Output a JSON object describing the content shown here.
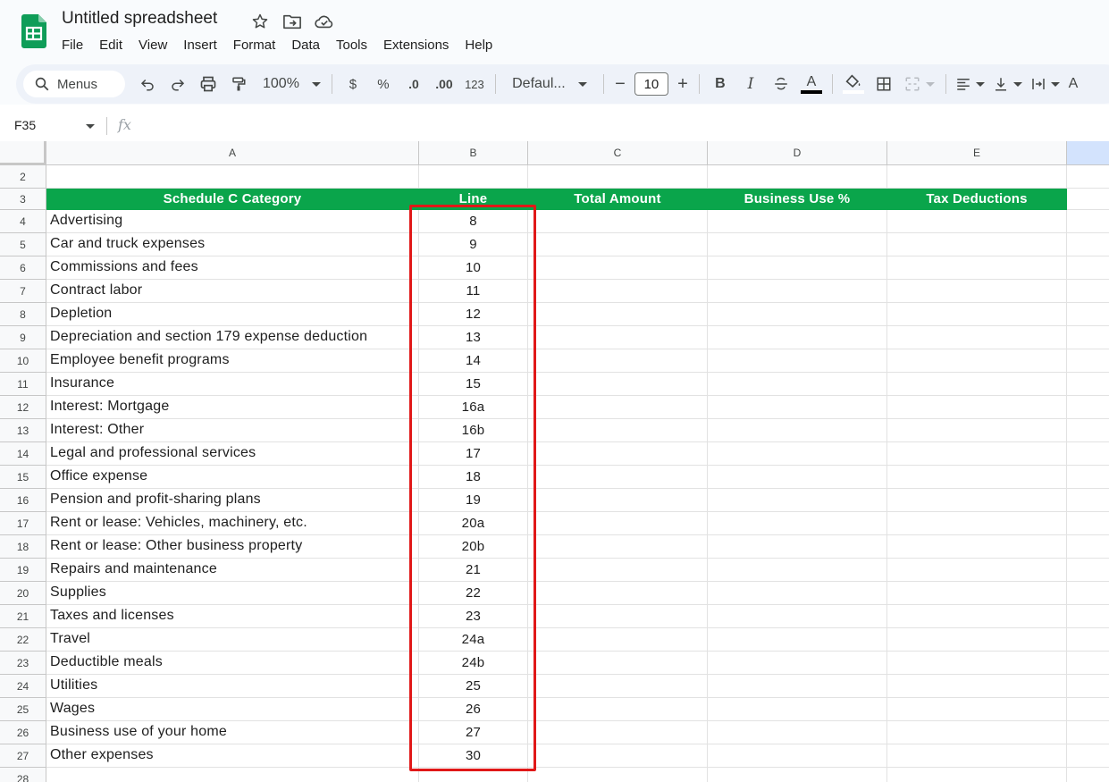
{
  "app": {
    "title": "Untitled spreadsheet",
    "menus": [
      "File",
      "Edit",
      "View",
      "Insert",
      "Format",
      "Data",
      "Tools",
      "Extensions",
      "Help"
    ]
  },
  "toolbar": {
    "search_label": "Menus",
    "zoom": "100%",
    "currency": "$",
    "percent": "%",
    "decrease_decimal": ".0",
    "increase_decimal": ".00",
    "number_format": "123",
    "font": "Defaul...",
    "font_size": "10",
    "minus": "−",
    "plus": "+",
    "bold": "B",
    "italic": "I",
    "text_color": "A"
  },
  "formula_bar": {
    "name_box": "F35",
    "fx": "fx"
  },
  "grid": {
    "columns": [
      "A",
      "B",
      "C",
      "D",
      "E"
    ],
    "header_row": {
      "row_number": "3",
      "cells": [
        "Schedule C Category",
        "Line",
        "Total Amount",
        "Business Use %",
        "Tax Deductions"
      ]
    },
    "top_rows": [
      "2"
    ],
    "bottom_rows": [
      "28"
    ],
    "rows": [
      {
        "n": "4",
        "category": "Advertising",
        "line": "8"
      },
      {
        "n": "5",
        "category": "Car and truck expenses",
        "line": "9"
      },
      {
        "n": "6",
        "category": "Commissions and fees",
        "line": "10"
      },
      {
        "n": "7",
        "category": "Contract labor",
        "line": "11"
      },
      {
        "n": "8",
        "category": "Depletion",
        "line": "12"
      },
      {
        "n": "9",
        "category": "Depreciation and section 179 expense deduction",
        "line": "13"
      },
      {
        "n": "10",
        "category": "Employee benefit programs",
        "line": "14"
      },
      {
        "n": "11",
        "category": "Insurance",
        "line": "15"
      },
      {
        "n": "12",
        "category": "Interest: Mortgage",
        "line": "16a"
      },
      {
        "n": "13",
        "category": "Interest: Other",
        "line": "16b"
      },
      {
        "n": "14",
        "category": "Legal and professional services",
        "line": "17"
      },
      {
        "n": "15",
        "category": "Office expense",
        "line": "18"
      },
      {
        "n": "16",
        "category": "Pension and profit-sharing plans",
        "line": "19"
      },
      {
        "n": "17",
        "category": "Rent or lease: Vehicles, machinery, etc.",
        "line": "20a"
      },
      {
        "n": "18",
        "category": "Rent or lease: Other business property",
        "line": "20b"
      },
      {
        "n": "19",
        "category": "Repairs and maintenance",
        "line": "21"
      },
      {
        "n": "20",
        "category": "Supplies",
        "line": "22"
      },
      {
        "n": "21",
        "category": "Taxes and licenses",
        "line": "23"
      },
      {
        "n": "22",
        "category": "Travel",
        "line": "24a"
      },
      {
        "n": "23",
        "category": "Deductible meals",
        "line": "24b"
      },
      {
        "n": "24",
        "category": "Utilities",
        "line": "25"
      },
      {
        "n": "25",
        "category": "Wages",
        "line": "26"
      },
      {
        "n": "26",
        "category": "Business use of your home",
        "line": "27"
      },
      {
        "n": "27",
        "category": "Other expenses",
        "line": "30"
      }
    ]
  },
  "colors": {
    "header_green": "#0aa54b",
    "highlight_red": "#e01818",
    "chrome_bg": "#f9fbfd",
    "toolbar_bg": "#eef2f9"
  }
}
